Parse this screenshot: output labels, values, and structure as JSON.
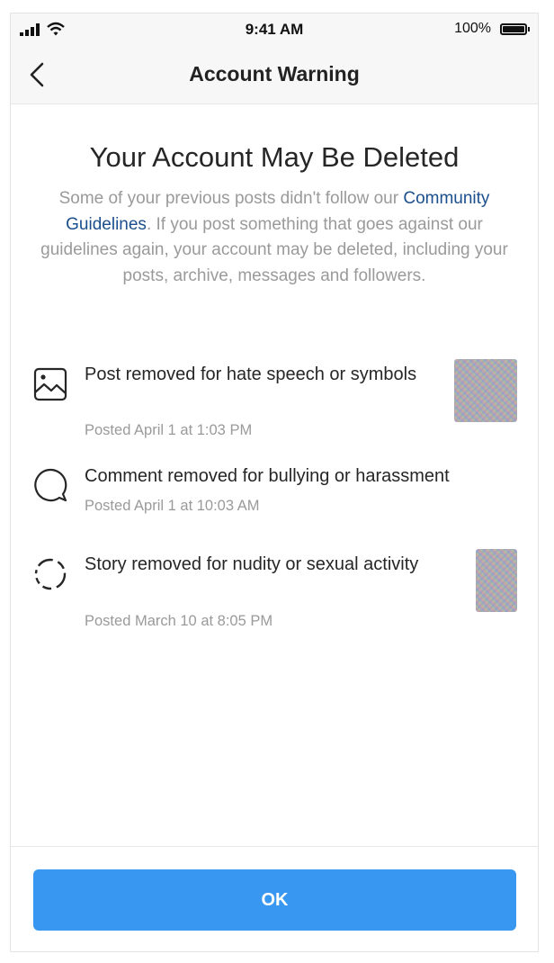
{
  "status_bar": {
    "time": "9:41 AM",
    "battery": "100%",
    "icons": [
      "signal-icon",
      "wifi-icon",
      "battery-icon"
    ]
  },
  "nav": {
    "title": "Account Warning",
    "back_icon": "chevron-left-icon"
  },
  "warning": {
    "heading": "Your Account May Be Deleted",
    "description_before": "Some of your previous posts didn't follow our ",
    "description_link": "Community Guidelines",
    "description_after": ". If you post something that goes against our guidelines again, your account may be deleted, including your posts, archive, messages and followers."
  },
  "violations": [
    {
      "icon": "image-icon",
      "text": "Post removed for hate speech or symbols",
      "date": "Posted April 1 at 1:03 PM"
    },
    {
      "icon": "comment-icon",
      "text": "Comment removed for bullying or harassment",
      "date": "Posted April 1 at 10:03 AM"
    },
    {
      "icon": "story-icon",
      "text": "Story removed for nudity or sexual activity",
      "date": "Posted March 10 at 8:05 PM"
    }
  ],
  "footer": {
    "ok_label": "OK"
  },
  "colors": {
    "button": "#3897f0",
    "link": "#1b4f8d",
    "muted_text": "#9a9a9a"
  }
}
